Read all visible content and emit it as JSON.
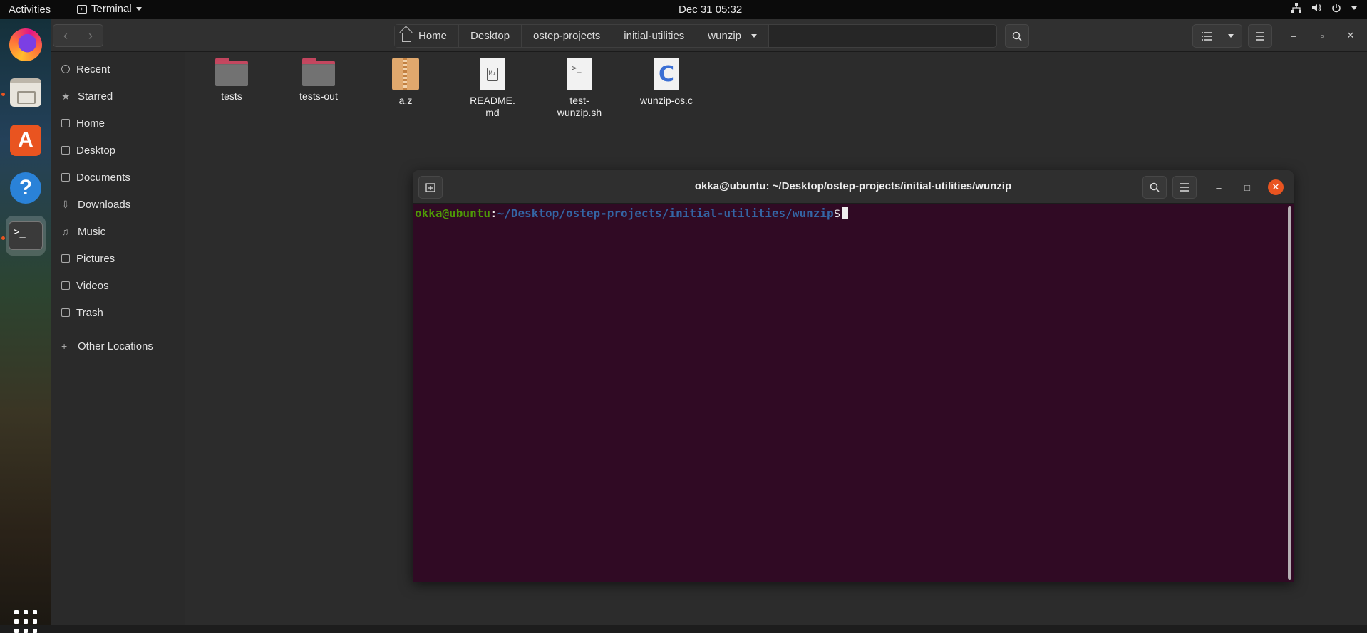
{
  "topbar": {
    "activities": "Activities",
    "app_name": "Terminal",
    "clock": "Dec 31  05:32"
  },
  "dock": {
    "items": [
      "firefox",
      "files",
      "ubuntu-software",
      "help",
      "terminal"
    ]
  },
  "files": {
    "breadcrumbs": [
      "Home",
      "Desktop",
      "ostep-projects",
      "initial-utilities",
      "wunzip"
    ],
    "sidebar": {
      "items": [
        "Recent",
        "Starred",
        "Home",
        "Desktop",
        "Documents",
        "Downloads",
        "Music",
        "Pictures",
        "Videos",
        "Trash"
      ],
      "other_locations": "Other Locations"
    },
    "items": [
      {
        "name": "tests",
        "type": "folder"
      },
      {
        "name": "tests-out",
        "type": "folder"
      },
      {
        "name": "a.z",
        "type": "archive"
      },
      {
        "name_line1": "README.",
        "name_line2": "md",
        "type": "markdown"
      },
      {
        "name_line1": "test-",
        "name_line2": "wunzip.sh",
        "type": "script"
      },
      {
        "name": "wunzip-os.c",
        "type": "c-source"
      }
    ]
  },
  "terminal": {
    "title": "okka@ubuntu: ~/Desktop/ostep-projects/initial-utilities/wunzip",
    "prompt_user": "okka@ubuntu",
    "prompt_colon": ":",
    "prompt_path": "~/Desktop/ostep-projects/initial-utilities/wunzip",
    "prompt_sign": "$",
    "colors": {
      "background": "#300a24",
      "user": "#4e9a06",
      "path": "#3465a4"
    }
  }
}
